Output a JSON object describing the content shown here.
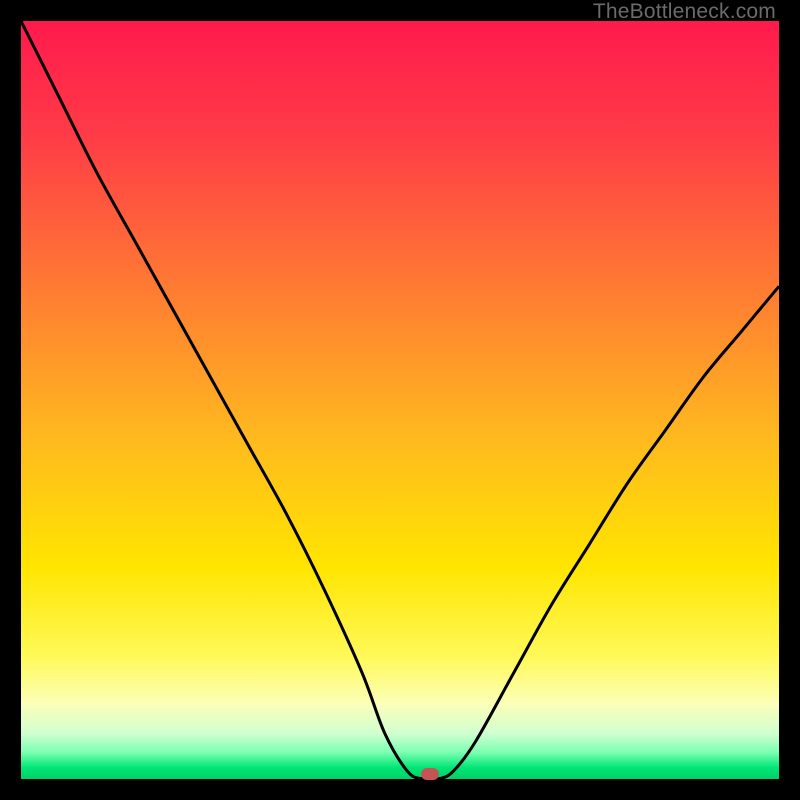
{
  "watermark": "TheBottleneck.com",
  "chart_data": {
    "type": "line",
    "title": "",
    "xlabel": "",
    "ylabel": "",
    "xlim": [
      0,
      100
    ],
    "ylim": [
      0,
      100
    ],
    "gradient_stops": [
      {
        "offset": 0.0,
        "color": "#ff1a4d"
      },
      {
        "offset": 0.15,
        "color": "#ff3b47"
      },
      {
        "offset": 0.35,
        "color": "#ff7a33"
      },
      {
        "offset": 0.55,
        "color": "#ffb91f"
      },
      {
        "offset": 0.72,
        "color": "#ffe500"
      },
      {
        "offset": 0.84,
        "color": "#fff95a"
      },
      {
        "offset": 0.9,
        "color": "#fcffb8"
      },
      {
        "offset": 0.94,
        "color": "#d0ffd0"
      },
      {
        "offset": 0.965,
        "color": "#7bffb0"
      },
      {
        "offset": 0.985,
        "color": "#00e676"
      },
      {
        "offset": 1.0,
        "color": "#00d068"
      }
    ],
    "series": [
      {
        "name": "bottleneck-curve",
        "x": [
          0.0,
          5,
          10,
          15,
          20,
          25,
          30,
          35,
          40,
          45,
          48,
          51,
          53,
          55,
          57,
          60,
          65,
          70,
          75,
          80,
          85,
          90,
          95,
          100
        ],
        "y": [
          100,
          90,
          80,
          71,
          62,
          53,
          44,
          35,
          25,
          14,
          6,
          1,
          0,
          0,
          1,
          5,
          14,
          23,
          31,
          39,
          46,
          53,
          59,
          65
        ]
      }
    ],
    "marker": {
      "x": 54,
      "y": 0.7,
      "color": "#c75454"
    }
  }
}
